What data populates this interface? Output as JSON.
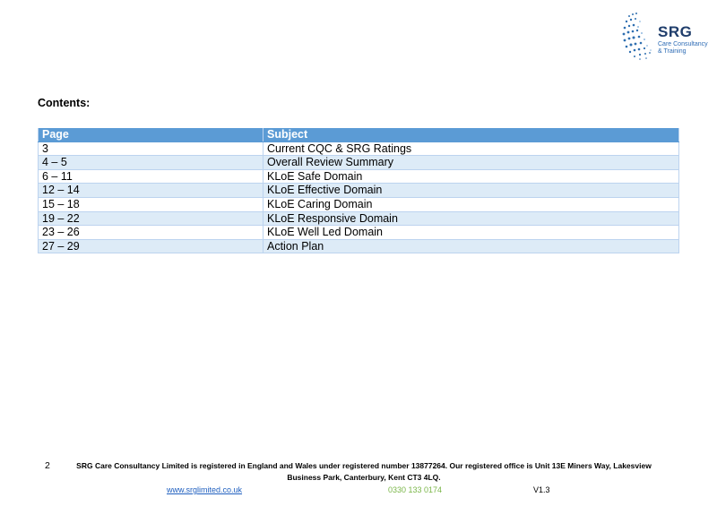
{
  "logo": {
    "name": "SRG",
    "tagline_line1": "Care Consultancy",
    "tagline_line2": "& Training"
  },
  "heading": "Contents:",
  "table": {
    "headers": [
      "Page",
      "Subject"
    ],
    "rows": [
      {
        "page": "3",
        "subject": "Current CQC & SRG Ratings"
      },
      {
        "page": "4 – 5",
        "subject": "Overall Review Summary"
      },
      {
        "page": "6 – 11",
        "subject": "KLoE Safe Domain"
      },
      {
        "page": "12 – 14",
        "subject": "KLoE Effective Domain"
      },
      {
        "page": "15 – 18",
        "subject": "KLoE Caring Domain"
      },
      {
        "page": "19 – 22",
        "subject": "KLoE Responsive Domain"
      },
      {
        "page": "23 – 26",
        "subject": "KLoE Well Led Domain"
      },
      {
        "page": "27 – 29",
        "subject": "Action Plan"
      }
    ]
  },
  "footer": {
    "page_number": "2",
    "registration_line1": "SRG Care Consultancy Limited is registered in England and Wales under registered number 13877264. Our registered office is Unit 13E Miners Way, Lakesview",
    "registration_line2": "Business Park, Canterbury, Kent CT3 4LQ.",
    "website": "www.srglimited.co.uk",
    "phone": "0330 133 0174",
    "version": "V1.3"
  },
  "colors": {
    "header_fill": "#5b9bd5",
    "stripe_fill": "#ddebf7",
    "logo_dark": "#1f3d6b",
    "link": "#1f5fbf",
    "phone": "#7ab648"
  }
}
